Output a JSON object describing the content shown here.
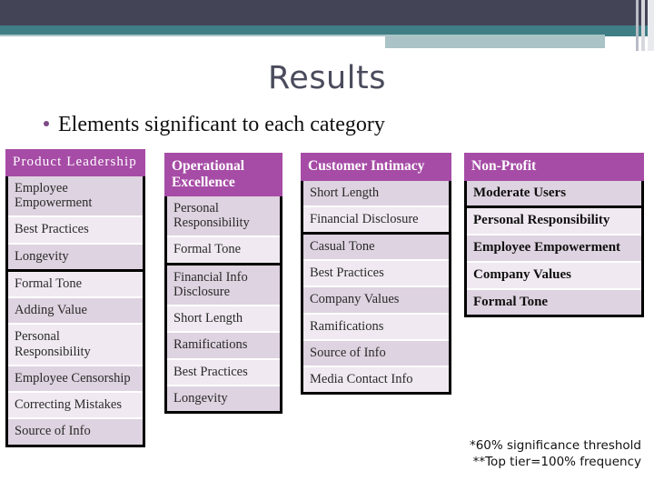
{
  "slide": {
    "title": "Results",
    "subtitle": "Elements significant to each category",
    "accent_purple": "#a64ca6",
    "row_dark": "#ded3e0",
    "row_light": "#f0e9f1",
    "banner_dark": "#434456",
    "banner_teal": "#3f7e85",
    "banner_pale": "#a9c3c6",
    "title_color": "#4a4b5c"
  },
  "footnotes": {
    "line1": "*60% significance threshold",
    "line2": "**Top tier=100% frequency"
  },
  "columns": [
    {
      "header": "Product Leadership",
      "top_group": [
        "Employee Empowerment",
        "Best Practices",
        "Longevity"
      ],
      "rest": [
        "Formal Tone",
        "Adding Value",
        "Personal Responsibility",
        "Employee Censorship",
        "Correcting Mistakes",
        "Source of Info"
      ]
    },
    {
      "header": "Operational Excellence",
      "top_group": [
        "Personal Responsibility",
        "Formal Tone"
      ],
      "rest": [
        "Financial Info Disclosure",
        "Short Length",
        "Ramifications",
        "Best Practices",
        "Longevity"
      ]
    },
    {
      "header": "Customer Intimacy",
      "top_group": [
        "Short Length",
        "Financial Disclosure"
      ],
      "rest": [
        "Casual Tone",
        "Best Practices",
        "Company Values",
        "Ramifications",
        "Source of Info",
        "Media Contact Info"
      ]
    },
    {
      "header": "Non-Profit",
      "top_group": [
        "Moderate Users"
      ],
      "rest": [
        "Personal Responsibility",
        "Employee Empowerment",
        "Company Values",
        "Formal Tone"
      ]
    }
  ]
}
